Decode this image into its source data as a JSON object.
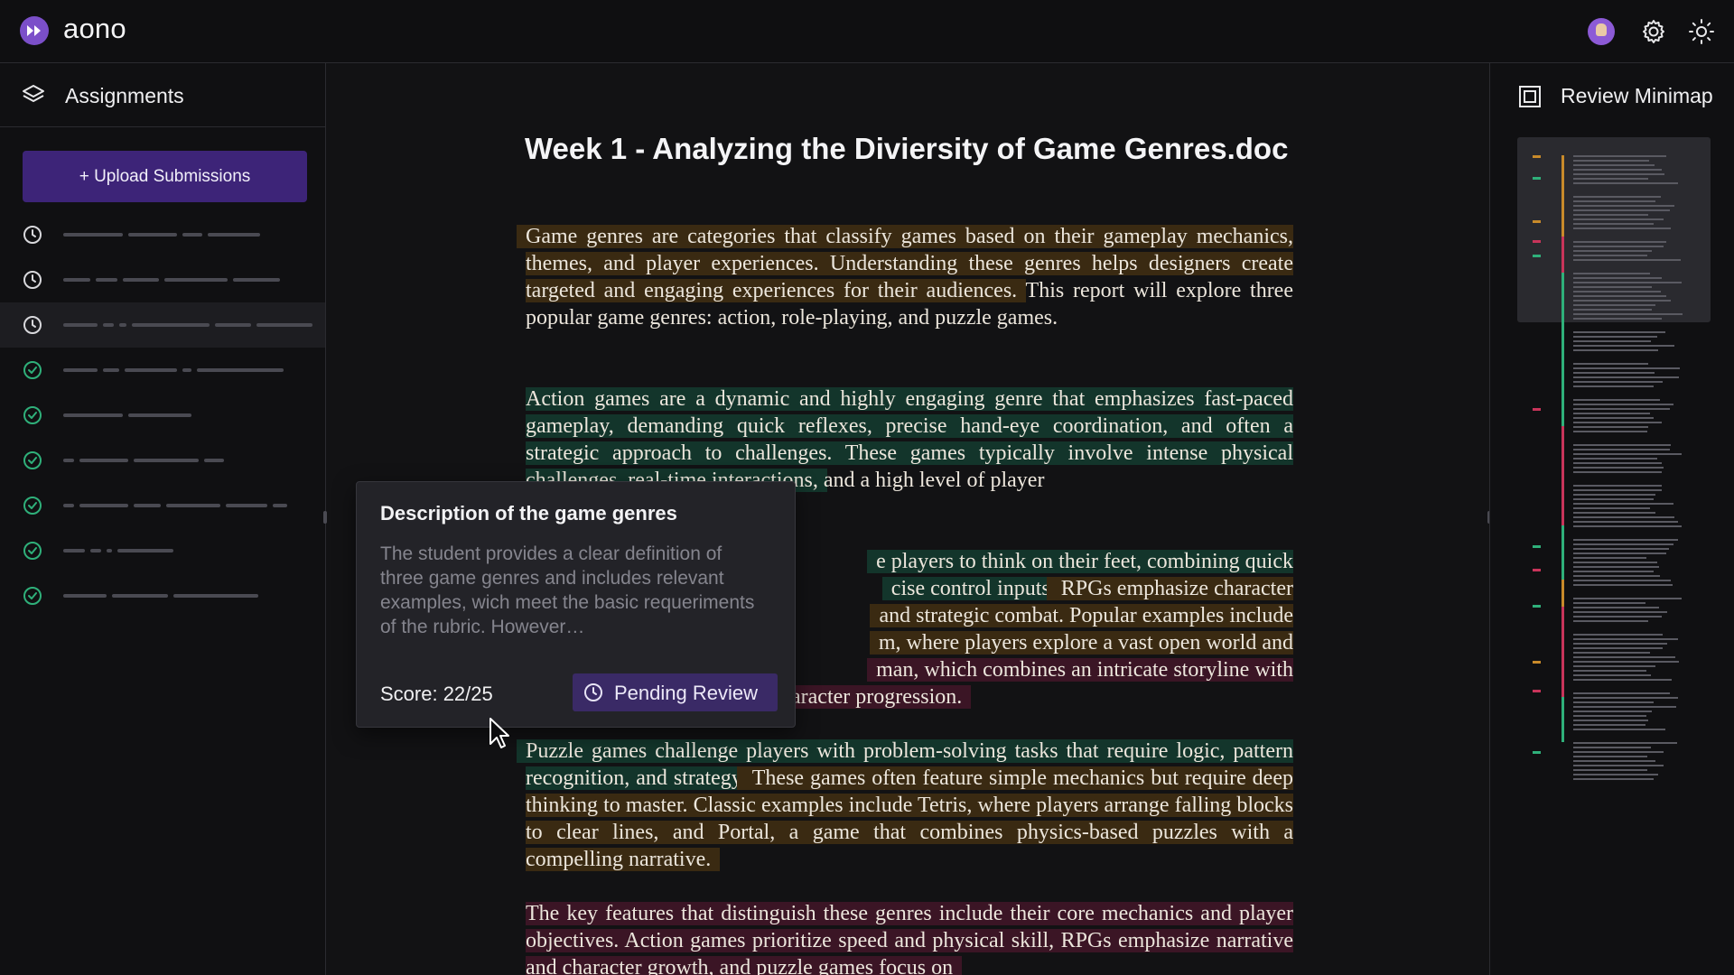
{
  "app": {
    "name": "aono"
  },
  "header": {
    "avatar": "user-avatar",
    "icons": [
      "settings-icon",
      "sun-icon"
    ]
  },
  "sidebar": {
    "title": "Assignments",
    "upload_label": "+ Upload Submissions",
    "items": [
      {
        "status": "pending"
      },
      {
        "status": "pending"
      },
      {
        "status": "pending",
        "active": true
      },
      {
        "status": "done"
      },
      {
        "status": "done"
      },
      {
        "status": "done"
      },
      {
        "status": "done"
      },
      {
        "status": "done"
      },
      {
        "status": "done"
      }
    ]
  },
  "document": {
    "title": "Week 1 - Analyzing the Diviersity of Game Genres.doc",
    "p1_a": "Game genres are categories that classify games based on their gameplay mechanics, themes, and player experiences. Understanding these genres helps designers create targeted and engaging experiences for their audiences.",
    "p1_b": " This report will explore three popular game genres: action, role-playing, and puzzle games.",
    "p2_a": "Action games are a dynamic and highly engaging genre that emphasizes fast-paced gameplay, demanding quick reflexes, precise hand-eye coordination, and often a strategic approach to challenges. These games typically involve intense physical challenges, real-time interactions,",
    "p2_b": " and a high level of player",
    "p3_a": "e players to think on their feet, combining quick",
    "p3_b": "cise control inputs.",
    "p3_c": " RPGs emphasize character",
    "p3_d": "and strategic combat. Popular examples include",
    "p3_e": "m, where players explore a vast open world and",
    "p3_f": "man, which combines an intricate storyline with",
    "p3_g": "aracter progression.",
    "p4_a": "Puzzle games challenge players with problem-solving tasks that require logic, pattern recognition, and strategy.",
    "p4_b": " These games often feature simple mechanics but require deep thinking to master. Classic examples include Tetris, where players arrange falling blocks to clear lines, and Portal, a game that combines physics-based puzzles with a compelling narrative.",
    "p5": "The key features that distinguish these genres include their core mechanics and player objectives. Action games prioritize speed and physical skill, RPGs emphasize narrative and character growth, and puzzle games focus on"
  },
  "card": {
    "title": "Description of the game genres",
    "description": "The student provides a clear definition of three game genres and includes relevant examples, wich meet the basic requeriments of the rubric. However…",
    "score": "Score: 22/25",
    "status": "Pending Review"
  },
  "right_panel": {
    "title": "Review Minimap"
  },
  "colors": {
    "accent": "#3d2478",
    "orange": "#c88a2a",
    "green": "#2fb07a",
    "red": "#c8345a"
  }
}
